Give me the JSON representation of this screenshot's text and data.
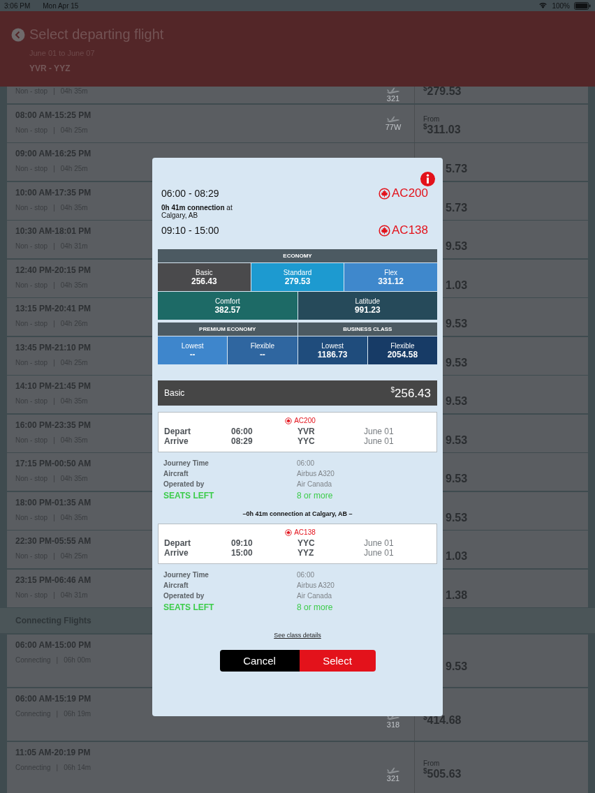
{
  "status_bar": {
    "time": "3:06 PM",
    "date": "Mon Apr 15",
    "battery": "100%"
  },
  "header": {
    "title": "Select departing flight",
    "dates": "June 01 to June 07",
    "route": "YVR - YYZ"
  },
  "nonstop": [
    {
      "stops": "Non - stop",
      "separator": "|",
      "duration": "04h 35m",
      "aircraft": [
        "321"
      ],
      "currency": "$",
      "amount": "279.53"
    },
    {
      "time": "08:00 AM-15:25 PM",
      "stops": "Non - stop",
      "separator": "|",
      "duration": "04h 25m",
      "aircraft": [
        "77W"
      ],
      "from_label": "From",
      "currency": "$",
      "amount": "311.03"
    },
    {
      "time": "09:00 AM-16:25 PM",
      "stops": "Non - stop",
      "separator": "|",
      "duration": "04h 25m",
      "amount": "5.73"
    },
    {
      "time": "10:00 AM-17:35 PM",
      "stops": "Non - stop",
      "separator": "|",
      "duration": "04h 35m",
      "amount": "5.73"
    },
    {
      "time": "10:30 AM-18:01 PM",
      "stops": "Non - stop",
      "separator": "|",
      "duration": "04h 31m",
      "amount": "9.53"
    },
    {
      "time": "12:40 PM-20:15 PM",
      "stops": "Non - stop",
      "separator": "|",
      "duration": "04h 35m",
      "amount": "1.03"
    },
    {
      "time": "13:15 PM-20:41 PM",
      "stops": "Non - stop",
      "separator": "|",
      "duration": "04h 26m",
      "amount": "9.53"
    },
    {
      "time": "13:45 PM-21:10 PM",
      "stops": "Non - stop",
      "separator": "|",
      "duration": "04h 25m",
      "amount": "9.53"
    },
    {
      "time": "14:10 PM-21:45 PM",
      "stops": "Non - stop",
      "separator": "|",
      "duration": "04h 35m",
      "amount": "9.53"
    },
    {
      "time": "16:00 PM-23:35 PM",
      "stops": "Non - stop",
      "separator": "|",
      "duration": "04h 35m",
      "amount": "9.53"
    },
    {
      "time": "17:15 PM-00:50 AM",
      "stops": "Non - stop",
      "separator": "|",
      "duration": "04h 35m",
      "amount": "9.53"
    },
    {
      "time": "18:00 PM-01:35 AM",
      "stops": "Non - stop",
      "separator": "|",
      "duration": "04h 35m",
      "amount": "9.53"
    },
    {
      "time": "22:30 PM-05:55 AM",
      "stops": "Non - stop",
      "separator": "|",
      "duration": "04h 25m",
      "amount": "1.03"
    },
    {
      "time": "23:15 PM-06:46 AM",
      "stops": "Non - stop",
      "separator": "|",
      "duration": "04h 31m",
      "amount": "1.38"
    }
  ],
  "connecting": {
    "title": "Connecting Flights",
    "flights": [
      {
        "time": "06:00 AM-15:00 PM",
        "stops": "Connecting",
        "separator": "|",
        "duration": "06h 00m",
        "amount": "9.53"
      },
      {
        "time": "06:00 AM-15:19 PM",
        "stops": "Connecting",
        "separator": "|",
        "duration": "06h 19m",
        "aircraft": [
          "318"
        ],
        "currency": "$",
        "amount": "414.68"
      },
      {
        "time": "11:05 AM-20:19 PM",
        "stops": "Connecting",
        "separator": "|",
        "duration": "06h 14m",
        "aircraft": [
          "321"
        ],
        "from_label": "From",
        "currency": "$",
        "amount": "505.63"
      }
    ]
  },
  "modal": {
    "summary": [
      {
        "times": "06:00 - 08:29",
        "flight": "AC200"
      },
      {
        "times": "09:10 - 15:00",
        "flight": "AC138"
      }
    ],
    "connection_note": "**0h 41m connection** at Calgary, AB",
    "economy": {
      "title": "ECONOMY",
      "rows": [
        [
          {
            "label": "Basic",
            "price": "256.43",
            "color": "#4a4a4c"
          },
          {
            "label": "Standard",
            "price": "279.53",
            "color": "#1d9ad0"
          },
          {
            "label": "Flex",
            "price": "331.12",
            "color": "#3f88cc"
          }
        ],
        [
          {
            "label": "Comfort",
            "price": "382.57",
            "color": "#1d6a66"
          },
          {
            "label": "Latitude",
            "price": "991.23",
            "color": "#264a5a"
          }
        ]
      ]
    },
    "groups": [
      {
        "title": "PREMIUM ECONOMY",
        "options": [
          {
            "label": "Lowest",
            "price": "--",
            "color": "#3e86cc"
          },
          {
            "label": "Flexible",
            "price": "--",
            "color": "#2f66a0"
          }
        ]
      },
      {
        "title": "BUSINESS CLASS",
        "options": [
          {
            "label": "Lowest",
            "price": "1186.73",
            "color": "#1f4c7c"
          },
          {
            "label": "Flexible",
            "price": "2054.58",
            "color": "#173b66"
          }
        ]
      }
    ],
    "selected_fare": {
      "label": "Basic",
      "currency": "$",
      "amount": "256.43"
    },
    "segments": [
      {
        "flight": "AC200",
        "legs": [
          {
            "label": "Depart",
            "time": "06:00",
            "airport": "YVR",
            "date": "June 01"
          },
          {
            "label": "Arrive",
            "time": "08:29",
            "airport": "YYC",
            "date": "June 01"
          }
        ],
        "details": [
          {
            "label": "Journey Time",
            "value": "06:00",
            "kind": "info"
          },
          {
            "label": "Aircraft",
            "value": "Airbus A320",
            "kind": "info"
          },
          {
            "label": "Operated by",
            "value": "Air Canada",
            "kind": "info"
          },
          {
            "label": "SEATS LEFT",
            "value": "8 or more",
            "kind": "seats"
          }
        ]
      },
      {
        "flight": "AC138",
        "legs": [
          {
            "label": "Depart",
            "time": "09:10",
            "airport": "YYC",
            "date": "June 01"
          },
          {
            "label": "Arrive",
            "time": "15:00",
            "airport": "YYZ",
            "date": "June 01"
          }
        ],
        "details": [
          {
            "label": "Journey Time",
            "value": "06:00",
            "kind": "info"
          },
          {
            "label": "Aircraft",
            "value": "Airbus A320",
            "kind": "info"
          },
          {
            "label": "Operated by",
            "value": "Air Canada",
            "kind": "info"
          },
          {
            "label": "SEATS LEFT",
            "value": "8 or more",
            "kind": "seats"
          }
        ]
      }
    ],
    "connection": "–0h 41m connection at Calgary, AB –",
    "details_link": "See class details",
    "buttons": [
      {
        "label": "Cancel",
        "kind": "cancel"
      },
      {
        "label": "Select",
        "kind": "confirm"
      }
    ]
  }
}
